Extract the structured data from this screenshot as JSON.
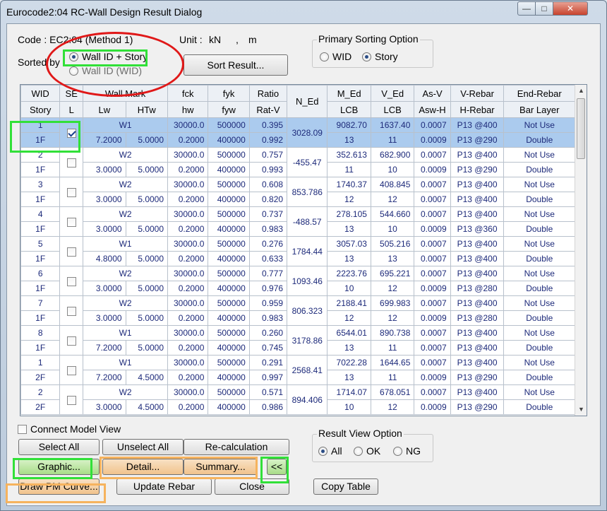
{
  "window": {
    "title": "Eurocode2:04 RC-Wall Design Result Dialog",
    "minimize": "—",
    "maximize": "□",
    "close": "✕"
  },
  "info": {
    "code_label": "Code : EC2:04 (Method 1)",
    "unit_label": "Unit :",
    "unit_force": "kN",
    "unit_sep": ",",
    "unit_length": "m",
    "sorted_by_label": "Sorted by",
    "sort_option_1": "Wall ID + Story",
    "sort_option_2": "Wall ID (WID)",
    "sort_button": "Sort Result..."
  },
  "primary_sorting": {
    "title": "Primary Sorting Option",
    "option_wid": "WID",
    "option_story": "Story",
    "selected": "Story"
  },
  "table": {
    "headers_top": [
      "WID",
      "SE",
      "Wall Mark",
      "fck",
      "fyk",
      "Ratio",
      "N_Ed",
      "M_Ed",
      "V_Ed",
      "As-V",
      "V-Rebar",
      "End-Rebar"
    ],
    "headers_bottom": [
      "Story",
      "L",
      "Lw",
      "HTw",
      "hw",
      "fyw",
      "Rat-V",
      "LCB",
      "LCB",
      "Asw-H",
      "H-Rebar",
      "Bar Layer"
    ],
    "rows": [
      {
        "wid": "1",
        "story": "1F",
        "checked": true,
        "mark": "W1",
        "lw": "7.2000",
        "htw": "5.0000",
        "fck": "30000.0",
        "hw": "0.2000",
        "fyk": "500000",
        "fyw": "400000",
        "ratio": "0.395",
        "ratv": "0.992",
        "ned": "3028.09",
        "med": "9082.70",
        "lcb1": "13",
        "ved": "1637.40",
        "lcb2": "11",
        "asv": "0.0007",
        "aswh": "0.0009",
        "vrebar": "P13 @400",
        "hrebar": "P13 @290",
        "end": "Not Use",
        "layer": "Double"
      },
      {
        "wid": "2",
        "story": "1F",
        "checked": false,
        "mark": "W2",
        "lw": "3.0000",
        "htw": "5.0000",
        "fck": "30000.0",
        "hw": "0.2000",
        "fyk": "500000",
        "fyw": "400000",
        "ratio": "0.757",
        "ratv": "0.993",
        "ned": "-455.47",
        "med": "352.613",
        "lcb1": "11",
        "ved": "682.900",
        "lcb2": "10",
        "asv": "0.0007",
        "aswh": "0.0009",
        "vrebar": "P13 @400",
        "hrebar": "P13 @290",
        "end": "Not Use",
        "layer": "Double"
      },
      {
        "wid": "3",
        "story": "1F",
        "checked": false,
        "mark": "W2",
        "lw": "3.0000",
        "htw": "5.0000",
        "fck": "30000.0",
        "hw": "0.2000",
        "fyk": "500000",
        "fyw": "400000",
        "ratio": "0.608",
        "ratv": "0.820",
        "ned": "853.786",
        "med": "1740.37",
        "lcb1": "12",
        "ved": "408.845",
        "lcb2": "12",
        "asv": "0.0007",
        "aswh": "0.0007",
        "vrebar": "P13 @400",
        "hrebar": "P13 @400",
        "end": "Not Use",
        "layer": "Double"
      },
      {
        "wid": "4",
        "story": "1F",
        "checked": false,
        "mark": "W2",
        "lw": "3.0000",
        "htw": "5.0000",
        "fck": "30000.0",
        "hw": "0.2000",
        "fyk": "500000",
        "fyw": "400000",
        "ratio": "0.737",
        "ratv": "0.983",
        "ned": "-488.57",
        "med": "278.105",
        "lcb1": "13",
        "ved": "544.660",
        "lcb2": "10",
        "asv": "0.0007",
        "aswh": "0.0009",
        "vrebar": "P13 @400",
        "hrebar": "P13 @360",
        "end": "Not Use",
        "layer": "Double"
      },
      {
        "wid": "5",
        "story": "1F",
        "checked": false,
        "mark": "W1",
        "lw": "4.8000",
        "htw": "5.0000",
        "fck": "30000.0",
        "hw": "0.2000",
        "fyk": "500000",
        "fyw": "400000",
        "ratio": "0.276",
        "ratv": "0.633",
        "ned": "1784.44",
        "med": "3057.03",
        "lcb1": "13",
        "ved": "505.216",
        "lcb2": "13",
        "asv": "0.0007",
        "aswh": "0.0007",
        "vrebar": "P13 @400",
        "hrebar": "P13 @400",
        "end": "Not Use",
        "layer": "Double"
      },
      {
        "wid": "6",
        "story": "1F",
        "checked": false,
        "mark": "W2",
        "lw": "3.0000",
        "htw": "5.0000",
        "fck": "30000.0",
        "hw": "0.2000",
        "fyk": "500000",
        "fyw": "400000",
        "ratio": "0.777",
        "ratv": "0.976",
        "ned": "1093.46",
        "med": "2223.76",
        "lcb1": "10",
        "ved": "695.221",
        "lcb2": "12",
        "asv": "0.0007",
        "aswh": "0.0009",
        "vrebar": "P13 @400",
        "hrebar": "P13 @280",
        "end": "Not Use",
        "layer": "Double"
      },
      {
        "wid": "7",
        "story": "1F",
        "checked": false,
        "mark": "W2",
        "lw": "3.0000",
        "htw": "5.0000",
        "fck": "30000.0",
        "hw": "0.2000",
        "fyk": "500000",
        "fyw": "400000",
        "ratio": "0.959",
        "ratv": "0.983",
        "ned": "806.323",
        "med": "2188.41",
        "lcb1": "12",
        "ved": "699.983",
        "lcb2": "12",
        "asv": "0.0007",
        "aswh": "0.0009",
        "vrebar": "P13 @400",
        "hrebar": "P13 @280",
        "end": "Not Use",
        "layer": "Double"
      },
      {
        "wid": "8",
        "story": "1F",
        "checked": false,
        "mark": "W1",
        "lw": "7.2000",
        "htw": "5.0000",
        "fck": "30000.0",
        "hw": "0.2000",
        "fyk": "500000",
        "fyw": "400000",
        "ratio": "0.260",
        "ratv": "0.745",
        "ned": "3178.86",
        "med": "6544.01",
        "lcb1": "13",
        "ved": "890.738",
        "lcb2": "11",
        "asv": "0.0007",
        "aswh": "0.0007",
        "vrebar": "P13 @400",
        "hrebar": "P13 @400",
        "end": "Not Use",
        "layer": "Double"
      },
      {
        "wid": "1",
        "story": "2F",
        "checked": false,
        "mark": "W1",
        "lw": "7.2000",
        "htw": "4.5000",
        "fck": "30000.0",
        "hw": "0.2000",
        "fyk": "500000",
        "fyw": "400000",
        "ratio": "0.291",
        "ratv": "0.997",
        "ned": "2568.41",
        "med": "7022.28",
        "lcb1": "13",
        "ved": "1644.65",
        "lcb2": "11",
        "asv": "0.0007",
        "aswh": "0.0009",
        "vrebar": "P13 @400",
        "hrebar": "P13 @290",
        "end": "Not Use",
        "layer": "Double"
      },
      {
        "wid": "2",
        "story": "2F",
        "checked": false,
        "mark": "W2",
        "lw": "3.0000",
        "htw": "4.5000",
        "fck": "30000.0",
        "hw": "0.2000",
        "fyk": "500000",
        "fyw": "400000",
        "ratio": "0.571",
        "ratv": "0.986",
        "ned": "894.406",
        "med": "1714.07",
        "lcb1": "10",
        "ved": "678.051",
        "lcb2": "12",
        "asv": "0.0007",
        "aswh": "0.0009",
        "vrebar": "P13 @400",
        "hrebar": "P13 @290",
        "end": "Not Use",
        "layer": "Double"
      }
    ]
  },
  "bottom": {
    "connect_model_view": "Connect Model View",
    "select_all": "Select All",
    "unselect_all": "Unselect All",
    "recalculation": "Re-calculation",
    "graphic": "Graphic...",
    "detail": "Detail...",
    "summary": "Summary...",
    "collapse": "<<",
    "draw_pm": "Draw PM Curve...",
    "update_rebar": "Update Rebar",
    "close": "Close",
    "copy_table": "Copy Table",
    "result_view_title": "Result View Option",
    "rv_all": "All",
    "rv_ok": "OK",
    "rv_ng": "NG"
  },
  "colors": {
    "selected_row": "#abcbee",
    "highlight_green": "#31e038",
    "highlight_orange": "#f6b35e",
    "highlight_red": "#e01818"
  }
}
